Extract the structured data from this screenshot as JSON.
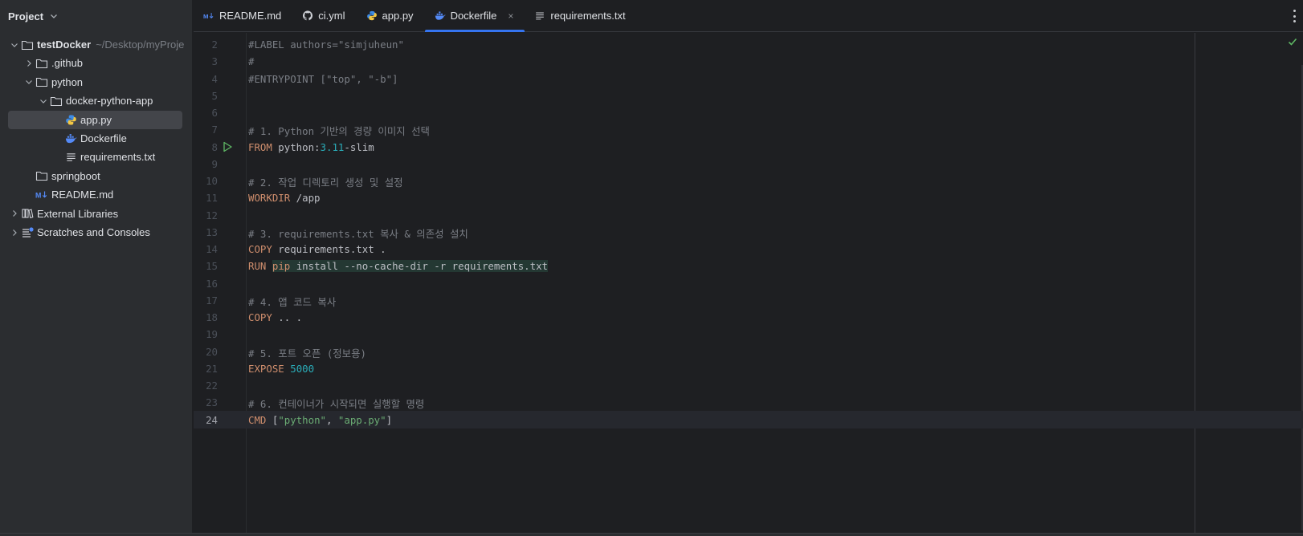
{
  "sidebar": {
    "title": "Project",
    "tree": [
      {
        "label": "testDocker",
        "path": "~/Desktop/myProje",
        "expanded": true,
        "icon": "folder-icon",
        "bold": true
      },
      {
        "label": ".github",
        "expanded": false,
        "icon": "folder-icon"
      },
      {
        "label": "python",
        "expanded": true,
        "icon": "folder-icon"
      },
      {
        "label": "docker-python-app",
        "expanded": true,
        "icon": "folder-icon"
      },
      {
        "label": "app.py",
        "icon": "python-file-icon",
        "selected": true
      },
      {
        "label": "Dockerfile",
        "icon": "docker-file-icon"
      },
      {
        "label": "requirements.txt",
        "icon": "text-file-icon"
      },
      {
        "label": "springboot",
        "icon": "folder-icon"
      },
      {
        "label": "README.md",
        "icon": "markdown-file-icon"
      },
      {
        "label": "External Libraries",
        "expanded": false,
        "icon": "library-icon"
      },
      {
        "label": "Scratches and Consoles",
        "expanded": false,
        "icon": "scratches-icon"
      }
    ]
  },
  "tabs": [
    {
      "label": "README.md",
      "icon": "markdown-file-icon"
    },
    {
      "label": "ci.yml",
      "icon": "github-icon"
    },
    {
      "label": "app.py",
      "icon": "python-file-icon"
    },
    {
      "label": "Dockerfile",
      "icon": "docker-file-icon",
      "active": true,
      "close": "×"
    },
    {
      "label": "requirements.txt",
      "icon": "text-file-icon"
    }
  ],
  "editor": {
    "current_line": "24",
    "lines": [
      {
        "n": "2",
        "parts": [
          {
            "t": "#LABEL authors=\"simjuheun\"",
            "c": "cm"
          }
        ]
      },
      {
        "n": "3",
        "parts": [
          {
            "t": "#",
            "c": "cm"
          }
        ]
      },
      {
        "n": "4",
        "parts": [
          {
            "t": "#ENTRYPOINT [\"top\", \"-b\"]",
            "c": "cm"
          }
        ]
      },
      {
        "n": "5",
        "parts": []
      },
      {
        "n": "6",
        "parts": []
      },
      {
        "n": "7",
        "parts": [
          {
            "t": "# 1. Python 기반의 경량 이미지 선택",
            "c": "cm"
          }
        ]
      },
      {
        "n": "8",
        "run": true,
        "parts": [
          {
            "t": "FROM",
            "c": "kw"
          },
          {
            "t": " python:"
          },
          {
            "t": "3.11",
            "c": "num-lit"
          },
          {
            "t": "-slim"
          }
        ]
      },
      {
        "n": "9",
        "parts": []
      },
      {
        "n": "10",
        "parts": [
          {
            "t": "# 2. 작업 디렉토리 생성 및 설정",
            "c": "cm"
          }
        ]
      },
      {
        "n": "11",
        "parts": [
          {
            "t": "WORKDIR",
            "c": "kw"
          },
          {
            "t": " /app"
          }
        ]
      },
      {
        "n": "12",
        "parts": []
      },
      {
        "n": "13",
        "parts": [
          {
            "t": "# 3. requirements.txt 복사 & 의존성 설치",
            "c": "cm"
          }
        ]
      },
      {
        "n": "14",
        "parts": [
          {
            "t": "COPY",
            "c": "kw"
          },
          {
            "t": " requirements.txt ."
          }
        ]
      },
      {
        "n": "15",
        "parts": [
          {
            "t": "RUN",
            "c": "kw"
          },
          {
            "t": " "
          },
          {
            "t": "pip",
            "c": "kw hl"
          },
          {
            "t": " install --no-cache-dir -r requirements.txt",
            "c": "hl"
          }
        ]
      },
      {
        "n": "16",
        "parts": []
      },
      {
        "n": "17",
        "parts": [
          {
            "t": "# 4. 앱 코드 복사",
            "c": "cm"
          }
        ]
      },
      {
        "n": "18",
        "parts": [
          {
            "t": "COPY",
            "c": "kw"
          },
          {
            "t": " .. ."
          }
        ]
      },
      {
        "n": "19",
        "parts": []
      },
      {
        "n": "20",
        "parts": [
          {
            "t": "# 5. 포트 오픈 (정보용)",
            "c": "cm"
          }
        ]
      },
      {
        "n": "21",
        "parts": [
          {
            "t": "EXPOSE",
            "c": "kw"
          },
          {
            "t": " "
          },
          {
            "t": "5000",
            "c": "num-lit"
          }
        ]
      },
      {
        "n": "22",
        "parts": []
      },
      {
        "n": "23",
        "parts": [
          {
            "t": "# 6. 컨테이너가 시작되면 실행할 명령",
            "c": "cm"
          }
        ]
      },
      {
        "n": "24",
        "parts": [
          {
            "t": "CMD",
            "c": "kw"
          },
          {
            "t": " ["
          },
          {
            "t": "\"python\"",
            "c": "str"
          },
          {
            "t": ", "
          },
          {
            "t": "\"app.py\"",
            "c": "str"
          },
          {
            "t": "]"
          }
        ]
      }
    ]
  },
  "colors": {
    "accent": "#3574f0",
    "keyword": "#cf8e6d",
    "comment": "#7a7e85",
    "number": "#2aacb8",
    "string": "#6aab73",
    "ok": "#5fb865"
  }
}
